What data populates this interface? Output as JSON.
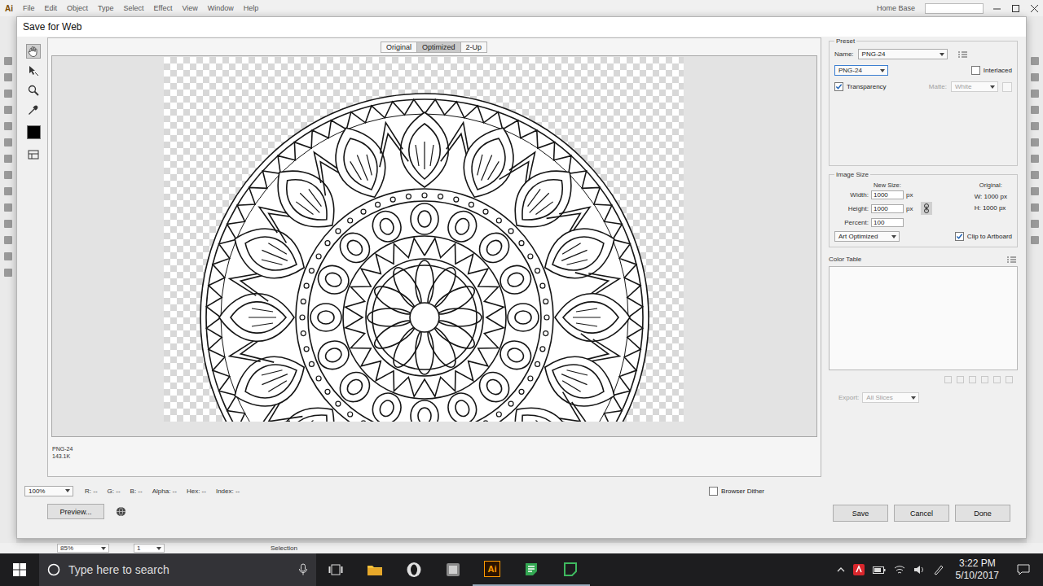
{
  "app": {
    "logo": "Ai",
    "menu": [
      "File",
      "Edit",
      "Object",
      "Type",
      "Select",
      "Effect",
      "View",
      "Window",
      "Help"
    ],
    "workspace": "Home Base"
  },
  "window": {
    "title": "Save for Web"
  },
  "tabs": [
    {
      "label": "Original",
      "selected": false
    },
    {
      "label": "Optimized",
      "selected": true
    },
    {
      "label": "2-Up",
      "selected": false
    }
  ],
  "preview": {
    "format": "PNG-24",
    "size": "143.1K"
  },
  "zoom": "100%",
  "readouts": [
    {
      "label": "R:",
      "value": "--"
    },
    {
      "label": "G:",
      "value": "--"
    },
    {
      "label": "B:",
      "value": "--"
    },
    {
      "label": "Alpha:",
      "value": "--"
    },
    {
      "label": "Hex:",
      "value": "--"
    },
    {
      "label": "Index:",
      "value": "--"
    }
  ],
  "browser_dither": {
    "label": "Browser Dither",
    "checked": false
  },
  "buttons": {
    "preview": "Preview...",
    "save": "Save",
    "cancel": "Cancel",
    "done": "Done"
  },
  "preset": {
    "section": "Preset",
    "name_label": "Name:",
    "name": "PNG-24",
    "format": "PNG-24",
    "interlaced": {
      "label": "Interlaced",
      "checked": false
    },
    "transparency": {
      "label": "Transparency",
      "checked": true
    },
    "matte": {
      "label": "Matte:",
      "value": "White",
      "disabled": true
    }
  },
  "image_size": {
    "section": "Image Size",
    "new_size": "New Size:",
    "fields": [
      {
        "label": "Width:",
        "value": "1000",
        "unit": "px"
      },
      {
        "label": "Height:",
        "value": "1000",
        "unit": "px"
      },
      {
        "label": "Percent:",
        "value": "100",
        "unit": ""
      }
    ],
    "original_label": "Original:",
    "original": [
      {
        "label": "W:",
        "value": "1000 px"
      },
      {
        "label": "H:",
        "value": "1000 px"
      }
    ],
    "resample": "Art Optimized",
    "clip": {
      "label": "Clip to Artboard",
      "checked": true
    }
  },
  "color_table": {
    "label": "Color Table"
  },
  "export": {
    "label": "Export:",
    "value": "All Slices",
    "disabled": true
  },
  "status_bar": {
    "zoom": "85%",
    "artboard": "1",
    "tool": "Selection"
  },
  "taskbar": {
    "search": "Type here to search",
    "time": "3:22 PM",
    "date": "5/10/2017"
  }
}
